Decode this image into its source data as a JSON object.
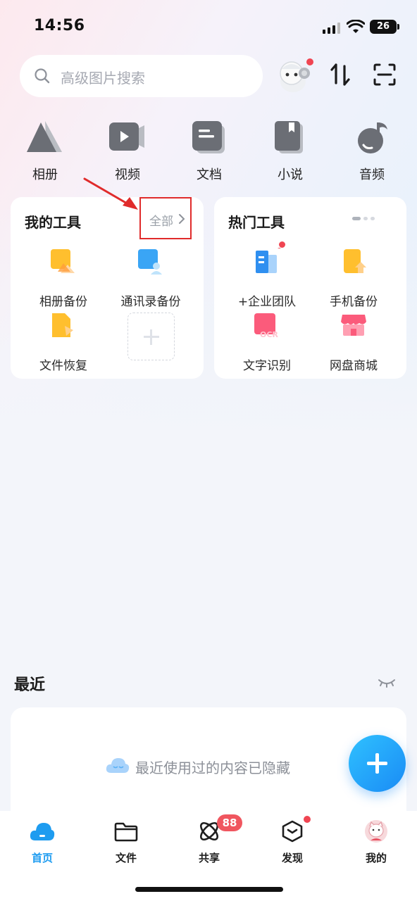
{
  "status_bar": {
    "time": "14:56",
    "battery": "26"
  },
  "search": {
    "placeholder": "高级图片搜索"
  },
  "header_icons": [
    "mascot-avatar",
    "transfer-icon",
    "scan-icon"
  ],
  "categories": [
    {
      "label": "相册",
      "icon": "album-icon"
    },
    {
      "label": "视频",
      "icon": "video-icon"
    },
    {
      "label": "文档",
      "icon": "document-icon"
    },
    {
      "label": "小说",
      "icon": "novel-icon"
    },
    {
      "label": "音频",
      "icon": "audio-icon"
    }
  ],
  "my_tools": {
    "title": "我的工具",
    "all_label": "全部",
    "items": [
      {
        "label": "相册备份",
        "icon": "album-backup-icon"
      },
      {
        "label": "通讯录备份",
        "icon": "contacts-backup-icon"
      },
      {
        "label": "文件恢复",
        "icon": "file-restore-icon"
      }
    ]
  },
  "hot_tools": {
    "title": "热门工具",
    "items": [
      {
        "label": "+企业团队",
        "icon": "enterprise-team-icon"
      },
      {
        "label": "手机备份",
        "icon": "phone-backup-icon"
      },
      {
        "label": "文字识别",
        "icon": "ocr-icon"
      },
      {
        "label": "网盘商城",
        "icon": "store-icon"
      }
    ]
  },
  "recent": {
    "title": "最近",
    "hidden_message": "最近使用过的内容已隐藏"
  },
  "tabbar": {
    "items": [
      {
        "label": "首页",
        "icon": "home-cloud-icon",
        "active": true
      },
      {
        "label": "文件",
        "icon": "folder-icon"
      },
      {
        "label": "共享",
        "icon": "share-icon"
      },
      {
        "label": "发现",
        "icon": "discover-icon"
      },
      {
        "label": "我的",
        "icon": "profile-avatar-icon"
      }
    ],
    "share_badge": "88"
  },
  "colors": {
    "accent": "#1e9cf0",
    "highlight_box": "#e02b2b",
    "badge": "#f0565f"
  }
}
